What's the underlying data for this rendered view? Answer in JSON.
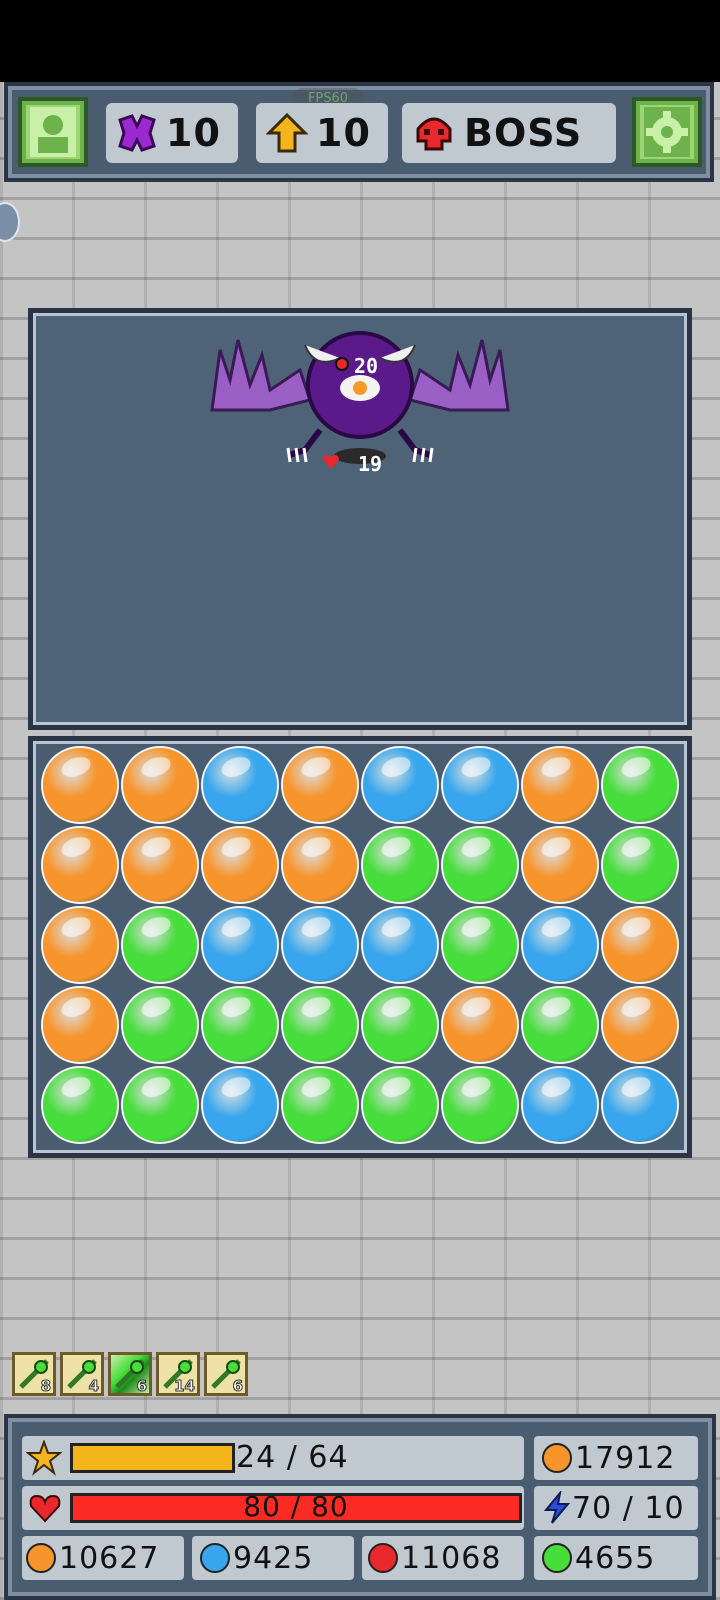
{
  "top_bar": {
    "fps_label": "FPS60",
    "gems": "10",
    "level": "10",
    "stage": "BOSS"
  },
  "enemy": {
    "attack": "20",
    "health": "19"
  },
  "board": {
    "rows": [
      [
        "orange",
        "orange",
        "blue",
        "orange",
        "blue",
        "blue",
        "orange",
        "green"
      ],
      [
        "orange",
        "orange",
        "orange",
        "orange",
        "green",
        "green",
        "orange",
        "green"
      ],
      [
        "orange",
        "green",
        "blue",
        "blue",
        "blue",
        "green",
        "blue",
        "orange"
      ],
      [
        "orange",
        "green",
        "green",
        "green",
        "green",
        "orange",
        "green",
        "orange"
      ],
      [
        "green",
        "green",
        "blue",
        "green",
        "green",
        "green",
        "blue",
        "blue"
      ]
    ]
  },
  "items": [
    {
      "name": "item-1",
      "count": "8"
    },
    {
      "name": "item-2",
      "count": "4"
    },
    {
      "name": "item-3",
      "count": "6"
    },
    {
      "name": "item-4",
      "count": "14"
    },
    {
      "name": "item-5",
      "count": "6"
    }
  ],
  "stats": {
    "xp_text": "24 / 64",
    "xp_fraction": 0.375,
    "gold": "17912",
    "hp_text": "80 / 80",
    "hp_fraction": 1.0,
    "mana": "70 / 10",
    "orange_orbs": "10627",
    "blue_orbs": "9425",
    "red_orbs": "11068",
    "green_orbs": "4655"
  },
  "colors": {
    "orange": "#f7952c",
    "blue": "#38a6ec",
    "green": "#47dd3a",
    "red": "#e8282c"
  }
}
